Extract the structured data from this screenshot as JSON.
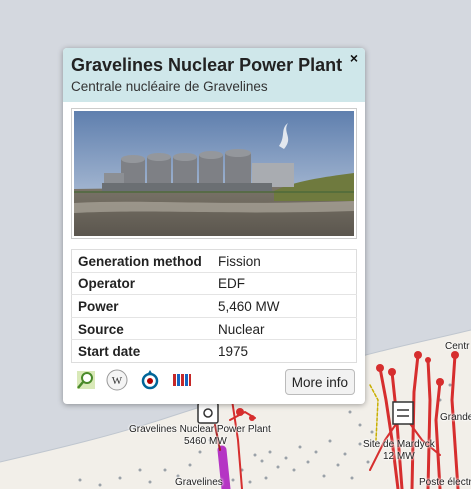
{
  "popup": {
    "title": "Gravelines Nuclear Power Plant",
    "subtitle": "Centrale nucléaire de Gravelines",
    "close_label": "×",
    "rows": [
      {
        "key": "Generation method",
        "value": "Fission"
      },
      {
        "key": "Operator",
        "value": "EDF"
      },
      {
        "key": "Power",
        "value": "5,460 MW"
      },
      {
        "key": "Source",
        "value": "Nuclear"
      },
      {
        "key": "Start date",
        "value": "1975"
      }
    ],
    "more_info_label": "More info",
    "links": [
      "wikidata-icon",
      "wikipedia-icon",
      "wikimedia-commons-icon",
      "gem-tracker-icon"
    ]
  },
  "map": {
    "labels": {
      "plant_name": "Gravelines Nuclear Power Plant",
      "plant_power": "5460 MW",
      "substation_name": "Site de Mardyck",
      "substation_power": "12 MW",
      "town": "Gravelines",
      "centr": "Centr",
      "grande": "Grande",
      "poste": "Poste électr"
    },
    "colors": {
      "land": "#f2efe9",
      "sea": "#d4d8df",
      "line_red": "#d62e2e",
      "line_dark_red": "#a51c1c",
      "line_yellow": "#c9b000",
      "line_magenta": "#b535c4"
    }
  }
}
